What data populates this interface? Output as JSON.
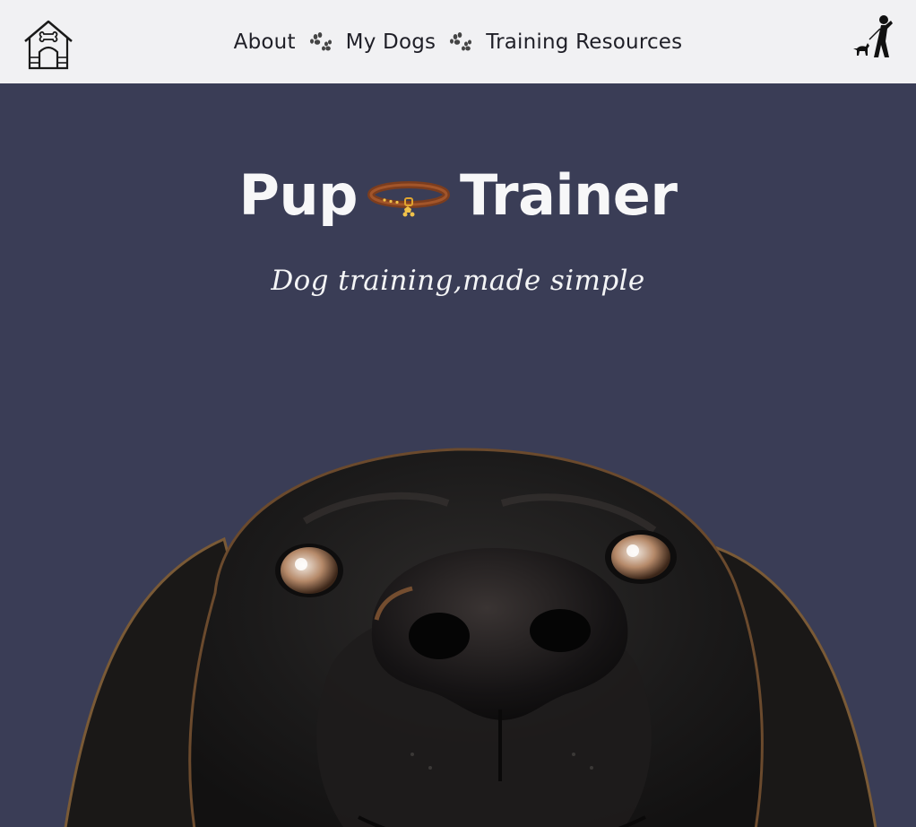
{
  "nav": {
    "home_icon": "dog-house-icon",
    "links": [
      {
        "label": "About"
      },
      {
        "label": "My Dogs"
      },
      {
        "label": "Training Resources"
      }
    ],
    "separator_icon": "paw-print-icon",
    "account_icon": "dog-walker-icon"
  },
  "hero": {
    "title_left": "Pup",
    "title_right": "Trainer",
    "title_icon": "dog-collar-icon",
    "tagline": "Dog training,made simple",
    "image": "black-labrador-looking-up"
  },
  "colors": {
    "nav_bg": "#f1f1f3",
    "hero_bg": "#3a3d56",
    "title_text": "#f7f7f8",
    "nav_text": "#1f1f27"
  }
}
